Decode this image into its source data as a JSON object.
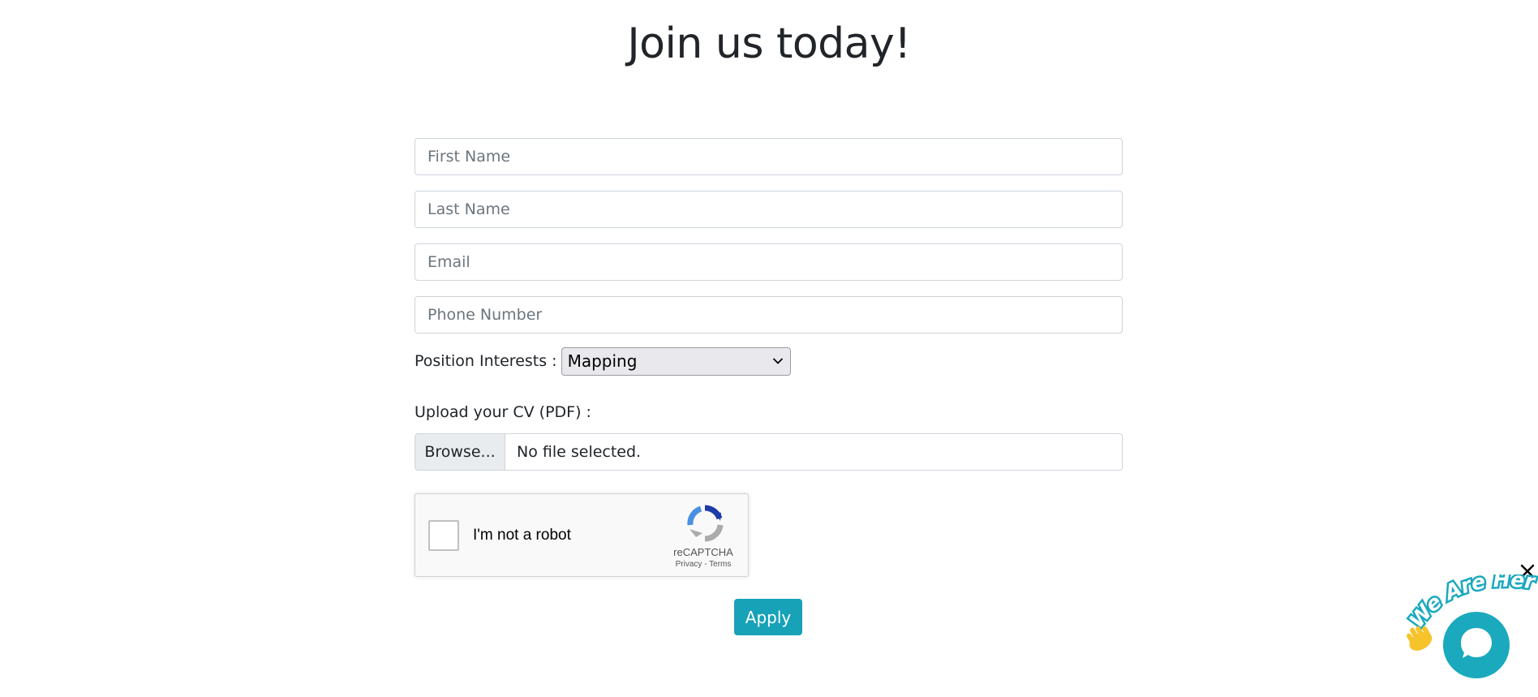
{
  "page": {
    "title": "Join us today!"
  },
  "form": {
    "first_name_placeholder": "First Name",
    "last_name_placeholder": "Last Name",
    "email_placeholder": "Email",
    "phone_placeholder": "Phone Number",
    "position_label": "Position Interests :",
    "position_selected": "Mapping",
    "cv_label": "Upload your CV (PDF) :",
    "browse_label": "Browse...",
    "file_status": "No file selected.",
    "apply_label": "Apply"
  },
  "recaptcha": {
    "label": "I'm not a robot",
    "brand": "reCAPTCHA",
    "privacy": "Privacy",
    "separator": " - ",
    "terms": "Terms"
  },
  "chat_widget": {
    "banner_text": "We Are Here!",
    "accent_color": "#1aa9bd"
  },
  "colors": {
    "apply_button": "#17a2b8"
  },
  "icons": {
    "select_arrow": "chevron-down-icon",
    "recaptcha": "recaptcha-logo-icon",
    "close": "close-icon",
    "wave": "waving-hand-icon",
    "chat": "chat-bubble-icon"
  }
}
